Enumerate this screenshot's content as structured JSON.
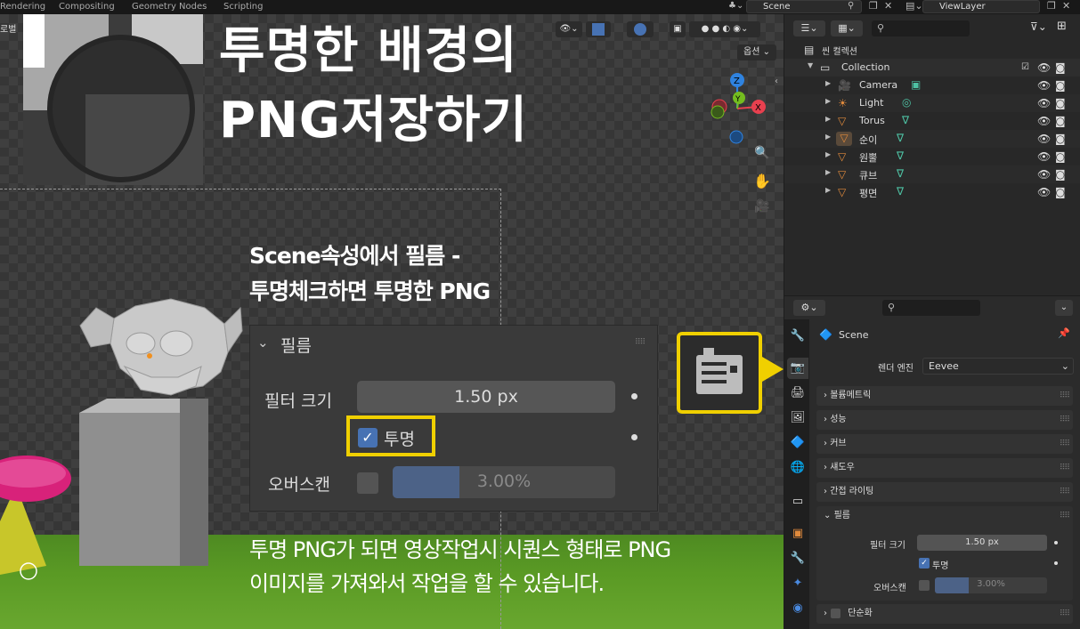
{
  "topbar": {
    "tabs": [
      "Rendering",
      "Compositing",
      "Geometry Nodes",
      "Scripting"
    ],
    "scene": "Scene",
    "viewlayer": "ViewLayer"
  },
  "viewport": {
    "left_label": "로벌",
    "options_label": "옵션 ⌄"
  },
  "overlay": {
    "title_line1": "투명한 배경의",
    "title_line2": "PNG저장하기",
    "subtitle_line1": "Scene속성에서 필름 -",
    "subtitle_line2": "투명체크하면 투명한 PNG",
    "bottom_line1": "투명 PNG가 되면 영상작업시 시퀀스 형태로 PNG",
    "bottom_line2": "이미지를 가져와서 작업을 할 수 있습니다."
  },
  "zoom_panel": {
    "header": "필름",
    "filter_label": "필터 크기",
    "filter_value": "1.50 px",
    "transparent_label": "투명",
    "overscan_label": "오버스캔",
    "overscan_value": "3.00%",
    "overscan_fraction": 0.3
  },
  "outliner": {
    "scene_collection": "씬 컬렉션",
    "collection": "Collection",
    "items": [
      {
        "name": "Camera"
      },
      {
        "name": "Light"
      },
      {
        "name": "Torus"
      },
      {
        "name": "순이"
      },
      {
        "name": "원뿔"
      },
      {
        "name": "큐브"
      },
      {
        "name": "평면"
      }
    ]
  },
  "properties": {
    "context": "Scene",
    "engine_label": "렌더 엔진",
    "engine_value": "Eevee",
    "sections": [
      "볼륨메트릭",
      "성능",
      "커브",
      "섀도우",
      "간접 라이팅"
    ],
    "film": {
      "header": "필름",
      "filter_label": "필터 크기",
      "filter_value": "1.50 px",
      "transparent_label": "투명",
      "overscan_label": "오버스캔",
      "overscan_value": "3.00%",
      "overscan_fraction": 0.3
    },
    "last_section": "단순화"
  },
  "colors": {
    "accent": "#4772b3",
    "highlight": "#f0d000",
    "grid_x": "#e8404f",
    "grid_y": "#74bc1f",
    "grid_z": "#2f83e0"
  }
}
